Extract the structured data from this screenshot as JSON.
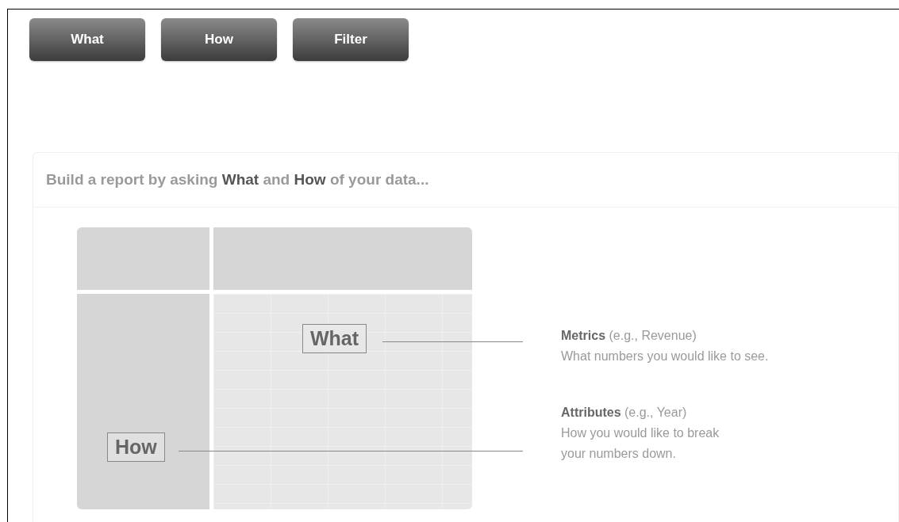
{
  "toolbar": {
    "buttons": [
      {
        "label": "What"
      },
      {
        "label": "How"
      },
      {
        "label": "Filter"
      }
    ]
  },
  "panel": {
    "heading": "Build a report by asking **What** and **How** of your data...",
    "diagram": {
      "what_label": "What",
      "how_label": "How"
    },
    "legend": [
      {
        "title": "**Metrics** (e.g., Revenue)",
        "description": "What numbers you would like to see."
      },
      {
        "title": "**Attributes** (e.g., Year)",
        "description": "How you would like to break your numbers down."
      }
    ]
  }
}
